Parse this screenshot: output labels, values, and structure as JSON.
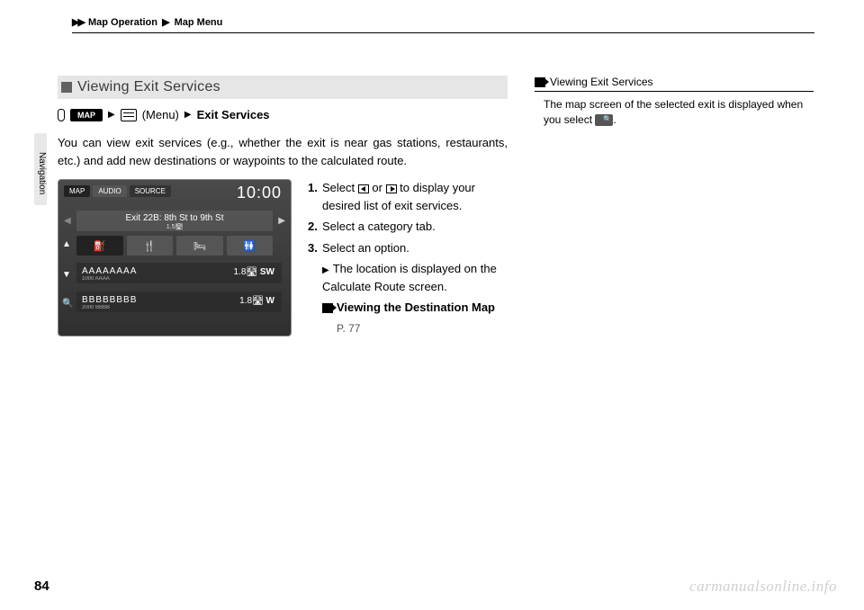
{
  "breadcrumb": {
    "seg1": "Map Operation",
    "seg2": "Map Menu"
  },
  "side_tab": "Navigation",
  "section": {
    "title": "Viewing Exit Services",
    "path_map": "MAP",
    "path_menu_label": "(Menu)",
    "path_target": "Exit Services",
    "intro": "You can view exit services (e.g., whether the exit is near gas stations, restaurants, etc.) and add new destinations or waypoints to the calculated route."
  },
  "device": {
    "tab_map": "MAP",
    "tab_audio": "AUDIO",
    "tab_source": "SOURCE",
    "clock": "10:00",
    "exit_line": "Exit 22B: 8th St to 9th St",
    "exit_sub": "1.5",
    "cat_fuel": "⛽",
    "cat_food": "🍴",
    "cat_lodging": "🛏",
    "cat_rest": "🚻",
    "row1_name": "AAAAAAAA",
    "row1_addr": "1000 AAAA",
    "row1_dist": "1.8",
    "row1_dir": "SW",
    "row2_name": "BBBBBBBB",
    "row2_addr": "2000 BBBB",
    "row2_dist": "1.8",
    "row2_dir": "W"
  },
  "steps": {
    "s1a": "Select ",
    "s1b": " or ",
    "s1c": " to display your desired list of exit services.",
    "s2": "Select a category tab.",
    "s3": "Select an option.",
    "s3_sub": "The location is displayed on the Calculate Route screen.",
    "xref_label": "Viewing the Destination Map",
    "xref_page": "P. 77"
  },
  "note": {
    "title": "Viewing Exit Services",
    "body_a": "The map screen of the selected exit is displayed when you select ",
    "body_b": "."
  },
  "page_number": "84",
  "watermark": "carmanualsonline.info"
}
